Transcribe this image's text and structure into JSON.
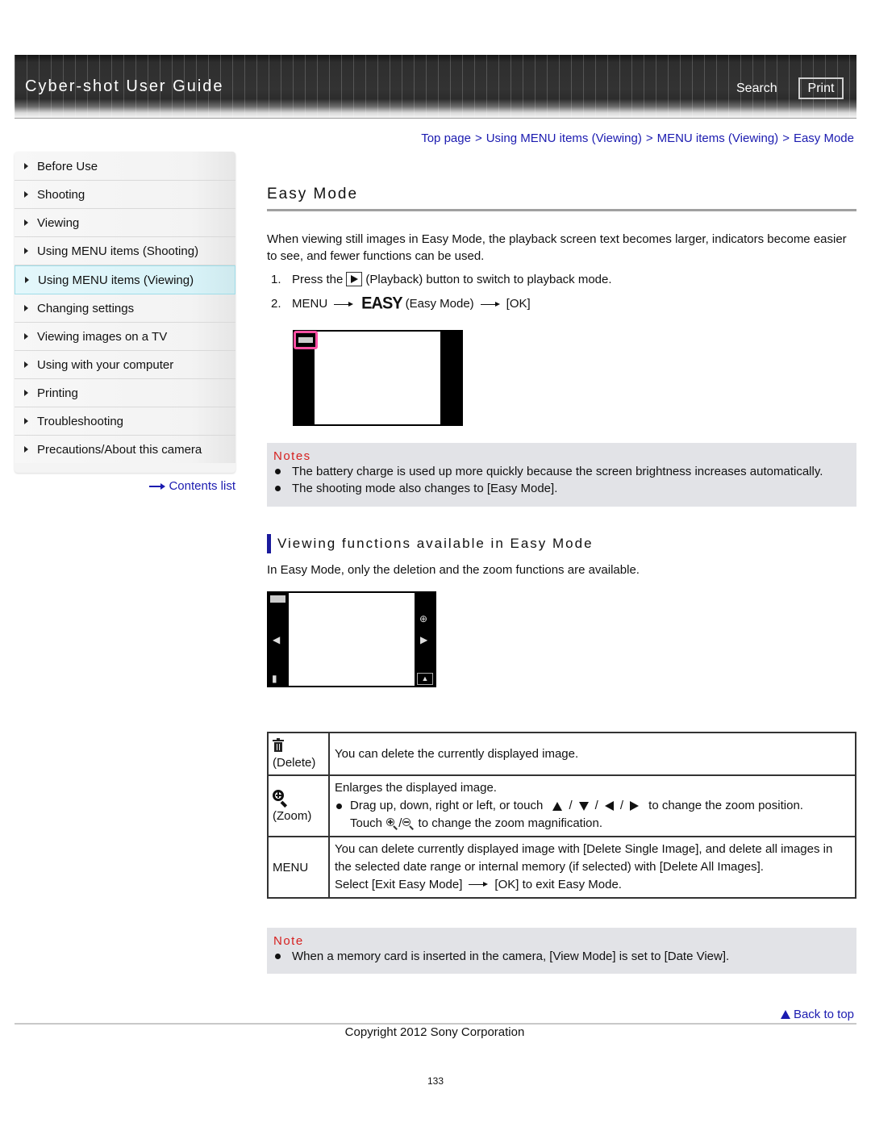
{
  "header": {
    "title": "Cyber-shot User Guide",
    "search_label": "Search",
    "print_label": "Print"
  },
  "breadcrumb": [
    {
      "label": "Top page"
    },
    {
      "label": "Using MENU items (Viewing)"
    },
    {
      "label": "MENU items (Viewing)"
    },
    {
      "label": "Easy Mode"
    }
  ],
  "breadcrumb_separator": ">",
  "sidebar": {
    "items": [
      {
        "label": "Before Use",
        "active": false
      },
      {
        "label": "Shooting",
        "active": false
      },
      {
        "label": "Viewing",
        "active": false
      },
      {
        "label": "Using MENU items (Shooting)",
        "active": false
      },
      {
        "label": "Using MENU items (Viewing)",
        "active": true
      },
      {
        "label": "Changing settings",
        "active": false
      },
      {
        "label": "Viewing images on a TV",
        "active": false
      },
      {
        "label": "Using with your computer",
        "active": false
      },
      {
        "label": "Printing",
        "active": false
      },
      {
        "label": "Troubleshooting",
        "active": false
      },
      {
        "label": "Precautions/About this camera",
        "active": false
      }
    ],
    "contents_list_label": "Contents list"
  },
  "main": {
    "title": "Easy Mode",
    "intro": "When viewing still images in Easy Mode, the playback screen text becomes larger, indicators become easier to see, and fewer functions can be used.",
    "steps": [
      {
        "num": "1.",
        "before": "Press the",
        "icon": "playback-icon",
        "after": "(Playback) button to switch to playback mode."
      },
      {
        "num": "2.",
        "menu": "MENU",
        "easy_glyph": "EASY",
        "easy_label": "(Easy Mode)",
        "ok": "[OK]"
      }
    ],
    "notes1": {
      "title": "Notes",
      "items": [
        "The battery charge is used up more quickly because the screen brightness increases automatically.",
        "The shooting mode also changes to [Easy Mode]."
      ]
    },
    "section": {
      "heading": "Viewing functions available in Easy Mode",
      "description": "In Easy Mode, only the deletion and the zoom functions are available."
    },
    "table": {
      "rows": [
        {
          "icon": "trash-icon",
          "label": "(Delete)",
          "text": "You can delete the currently displayed image."
        },
        {
          "icon": "zoom-in-icon",
          "label": "(Zoom)",
          "line1": "Enlarges the displayed image.",
          "bullet_before": "Drag up, down, right or left, or touch",
          "bullet_after": "to change the zoom position.",
          "slash": "/",
          "touch": "Touch",
          "touch_after": "to change the zoom magnification."
        },
        {
          "label": "MENU",
          "line1": "You can delete currently displayed image with [Delete Single Image], and delete all images in the selected date range or internal memory (if selected) with [Delete All Images].",
          "line2_before": "Select [Exit Easy Mode]",
          "line2_after": "[OK] to exit Easy Mode."
        }
      ]
    },
    "notes2": {
      "title": "Note",
      "items": [
        "When a memory card is inserted in the camera, [View Mode] is set to [Date View]."
      ]
    }
  },
  "footer": {
    "back_to_top": "Back to top",
    "copyright": "Copyright 2012 Sony Corporation",
    "page_number": "133"
  },
  "colors": {
    "link": "#1b1bb0",
    "note_title": "#d6201f",
    "notes_bg": "#e2e3e7",
    "active_nav": "#d8f3f8",
    "highlight_ring": "#ff4fa3",
    "section_bar": "#1a1a9c"
  }
}
